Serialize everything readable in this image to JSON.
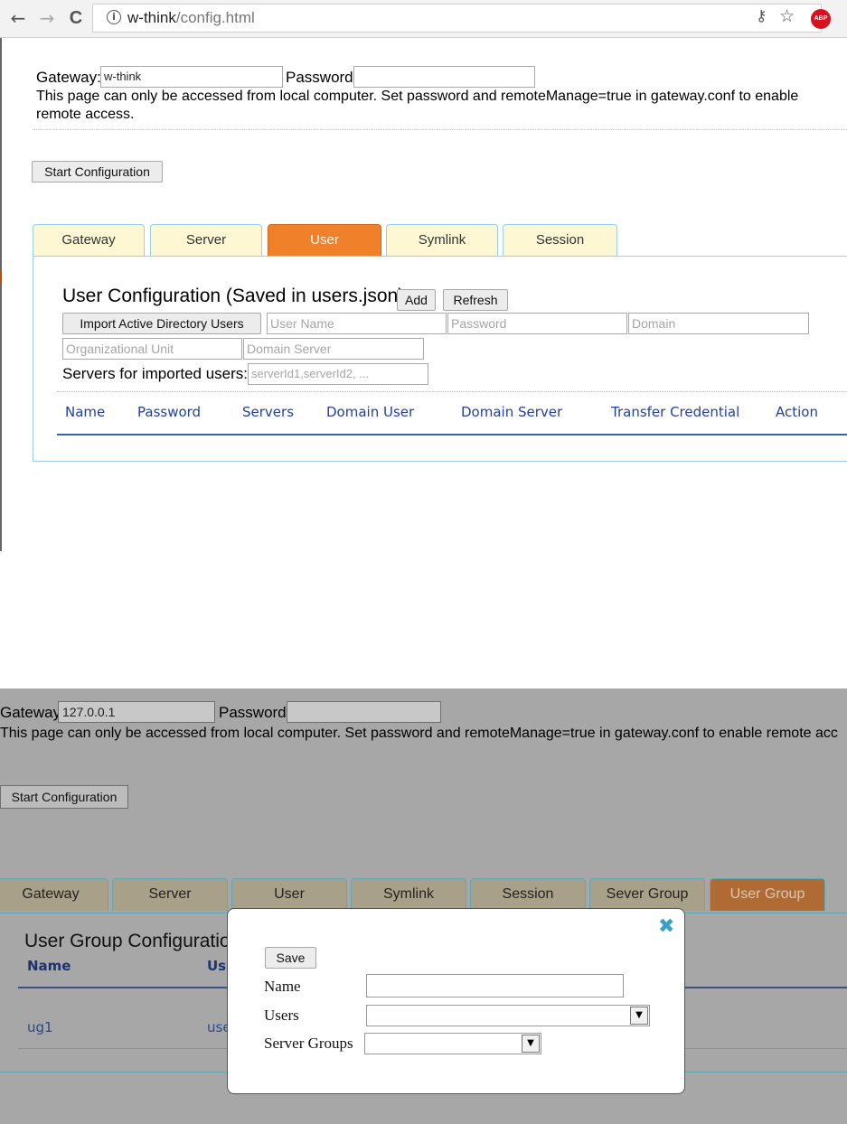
{
  "browser": {
    "back_icon": "←",
    "forward_icon": "→",
    "reload_icon": "C",
    "info_icon": "i",
    "url_host": "w-think",
    "url_path": "/config.html",
    "key_icon": "⚷",
    "star_icon": "☆",
    "abp_label": "ABP"
  },
  "panel1": {
    "gateway_label": "Gateway:",
    "gateway_value": "w-think",
    "password_label": "Password:",
    "password_value": "",
    "notice": "This page can only be accessed from local computer. Set password and remoteManage=true in gateway.conf to enable remote access.",
    "start_button": "Start Configuration",
    "tabs": [
      {
        "label": "Gateway"
      },
      {
        "label": "Server"
      },
      {
        "label": "User"
      },
      {
        "label": "Symlink"
      },
      {
        "label": "Session"
      }
    ],
    "active_tab": "User",
    "section_title": "User Configuration (Saved in users.json)",
    "add_button": "Add",
    "refresh_button": "Refresh",
    "import_button": "Import Active Directory Users",
    "placeholders": {
      "user_name": "User Name",
      "password": "Password",
      "domain": "Domain",
      "org_unit": "Organizational Unit",
      "domain_server": "Domain Server",
      "servers": "serverId1,serverId2, ..."
    },
    "servers_label": "Servers for imported users:",
    "columns": [
      "Name",
      "Password",
      "Servers",
      "Domain User",
      "Domain Server",
      "Transfer Credential",
      "Action"
    ]
  },
  "panel2": {
    "gateway_label": "Gateway:",
    "gateway_value": "127.0.0.1",
    "password_label": "Password:",
    "password_value": "",
    "notice": "This page can only be accessed from local computer. Set password and remoteManage=true in gateway.conf to enable remote acc",
    "start_button": "Start Configuration",
    "tabs": [
      {
        "label": "Gateway"
      },
      {
        "label": "Server"
      },
      {
        "label": "User"
      },
      {
        "label": "Symlink"
      },
      {
        "label": "Session"
      },
      {
        "label": "Sever Group"
      },
      {
        "label": "User Group"
      }
    ],
    "active_tab": "User Group",
    "section_title": "User Group Configuratior",
    "columns": [
      "Name",
      "Use"
    ],
    "rows": [
      {
        "name": "ug1",
        "users": "use"
      }
    ],
    "dialog": {
      "close_icon": "✖",
      "save_button": "Save",
      "name_label": "Name",
      "users_label": "Users",
      "server_groups_label": "Server Groups",
      "dropdown_icon": "▼"
    }
  },
  "colors": {
    "active_tab": "#f0812a",
    "tab_bg": "#fdf7d4",
    "tab_border": "#9acfe8",
    "column_header": "#223fa0",
    "abp_red": "#d9111f",
    "close_blue": "#3a9ec9"
  }
}
